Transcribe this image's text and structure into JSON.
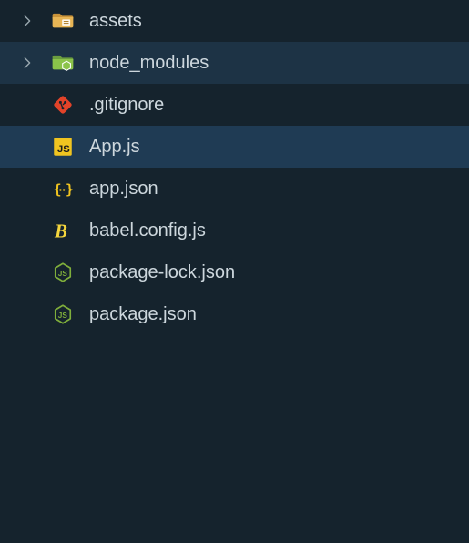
{
  "tree": {
    "items": [
      {
        "label": "assets",
        "type": "folder",
        "iconColor": "#e7b555",
        "expanded": false,
        "depth": 0,
        "selected": false,
        "hovered": false,
        "folderVariant": "assets"
      },
      {
        "label": "node_modules",
        "type": "folder",
        "iconColor": "#88c057",
        "expanded": false,
        "depth": 0,
        "selected": false,
        "hovered": true,
        "folderVariant": "node_modules"
      },
      {
        "label": ".gitignore",
        "type": "file-git",
        "iconColor": "#e24329",
        "depth": 0,
        "selected": false,
        "hovered": false
      },
      {
        "label": "App.js",
        "type": "file-js",
        "iconColor": "#f0c420",
        "depth": 0,
        "selected": true,
        "hovered": false
      },
      {
        "label": "app.json",
        "type": "file-json",
        "iconColor": "#f0c420",
        "depth": 0,
        "selected": false,
        "hovered": false
      },
      {
        "label": "babel.config.js",
        "type": "file-babel",
        "iconColor": "#f5d63d",
        "depth": 0,
        "selected": false,
        "hovered": false
      },
      {
        "label": "package-lock.json",
        "type": "file-node",
        "iconColor": "#7fae3b",
        "depth": 0,
        "selected": false,
        "hovered": false
      },
      {
        "label": "package.json",
        "type": "file-node",
        "iconColor": "#7fae3b",
        "depth": 0,
        "selected": false,
        "hovered": false
      }
    ]
  },
  "colors": {
    "bg": "#15232d",
    "rowHover": "#1d3345",
    "rowSelected": "#1f3b54",
    "text": "#cdd7dd",
    "chevron": "#9aa8af"
  }
}
